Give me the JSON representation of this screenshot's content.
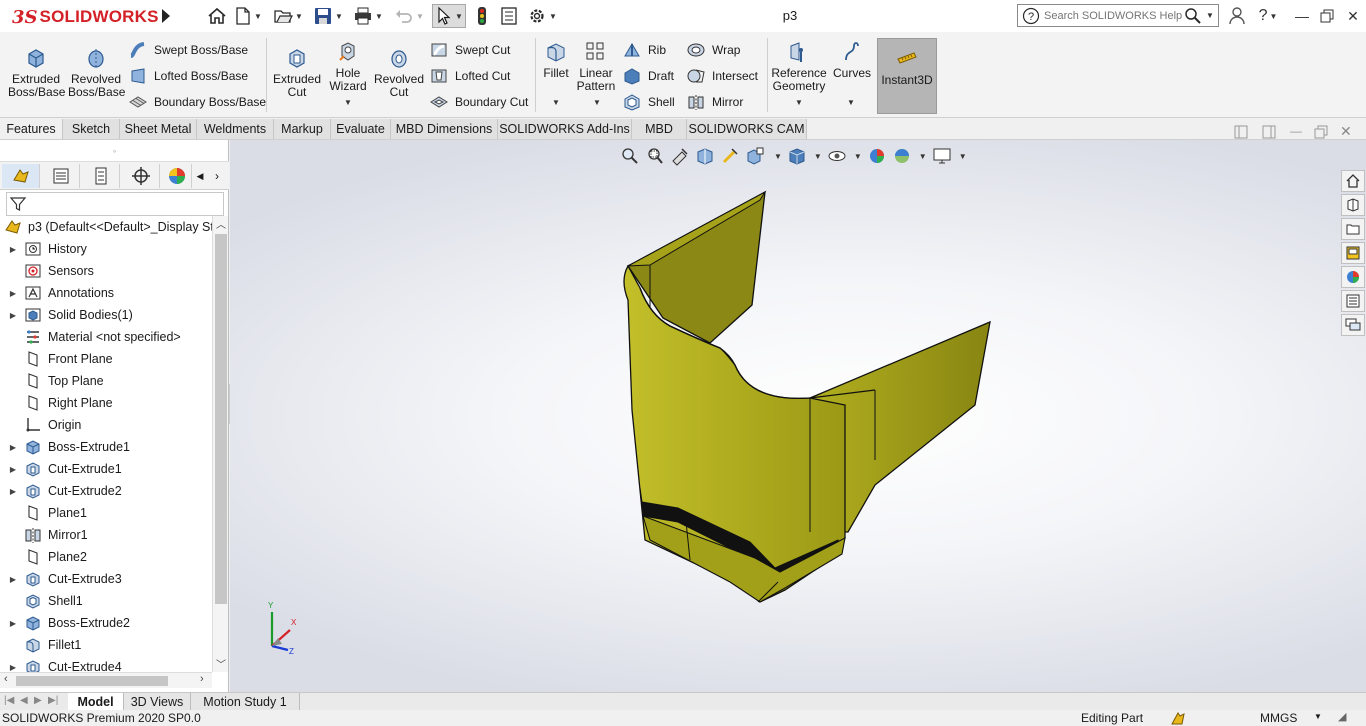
{
  "app": {
    "brand_ds": "3S",
    "brand_name": "SOLIDWORKS",
    "document_title": "p3"
  },
  "search": {
    "placeholder": "Search SOLIDWORKS Help"
  },
  "ribbon": {
    "extruded_boss": "Extruded\nBoss/Base",
    "revolved_boss": "Revolved\nBoss/Base",
    "swept_boss": "Swept Boss/Base",
    "lofted_boss": "Lofted Boss/Base",
    "boundary_boss": "Boundary Boss/Base",
    "extruded_cut": "Extruded\nCut",
    "hole_wizard": "Hole\nWizard",
    "revolved_cut": "Revolved\nCut",
    "swept_cut": "Swept Cut",
    "lofted_cut": "Lofted Cut",
    "boundary_cut": "Boundary Cut",
    "fillet": "Fillet",
    "linear_pattern": "Linear\nPattern",
    "rib": "Rib",
    "draft": "Draft",
    "shell": "Shell",
    "wrap": "Wrap",
    "intersect": "Intersect",
    "mirror": "Mirror",
    "reference_geometry": "Reference\nGeometry",
    "curves": "Curves",
    "instant3d": "Instant3D"
  },
  "tabs": [
    "Features",
    "Sketch",
    "Sheet Metal",
    "Weldments",
    "Markup",
    "Evaluate",
    "MBD Dimensions",
    "SOLIDWORKS Add-Ins",
    "MBD",
    "SOLIDWORKS CAM"
  ],
  "tree": {
    "root": "p3  (Default<<Default>_Display Sta",
    "nodes": [
      {
        "label": "History",
        "expand": true,
        "icon": "history-icon"
      },
      {
        "label": "Sensors",
        "expand": false,
        "icon": "sensors-icon"
      },
      {
        "label": "Annotations",
        "expand": true,
        "icon": "annotations-icon"
      },
      {
        "label": "Solid Bodies(1)",
        "expand": true,
        "icon": "solid-bodies-icon"
      },
      {
        "label": "Material <not specified>",
        "expand": false,
        "icon": "material-icon"
      },
      {
        "label": "Front Plane",
        "expand": false,
        "icon": "plane-icon"
      },
      {
        "label": "Top Plane",
        "expand": false,
        "icon": "plane-icon"
      },
      {
        "label": "Right Plane",
        "expand": false,
        "icon": "plane-icon"
      },
      {
        "label": "Origin",
        "expand": false,
        "icon": "origin-icon"
      },
      {
        "label": "Boss-Extrude1",
        "expand": true,
        "icon": "boss-extrude-icon"
      },
      {
        "label": "Cut-Extrude1",
        "expand": true,
        "icon": "cut-extrude-icon"
      },
      {
        "label": "Cut-Extrude2",
        "expand": true,
        "icon": "cut-extrude-icon"
      },
      {
        "label": "Plane1",
        "expand": false,
        "icon": "plane-icon"
      },
      {
        "label": "Mirror1",
        "expand": false,
        "icon": "mirror-icon"
      },
      {
        "label": "Plane2",
        "expand": false,
        "icon": "plane-icon"
      },
      {
        "label": "Cut-Extrude3",
        "expand": true,
        "icon": "cut-extrude-icon"
      },
      {
        "label": "Shell1",
        "expand": false,
        "icon": "shell-icon"
      },
      {
        "label": "Boss-Extrude2",
        "expand": true,
        "icon": "boss-extrude-icon"
      },
      {
        "label": "Fillet1",
        "expand": false,
        "icon": "fillet-icon"
      },
      {
        "label": "Cut-Extrude4",
        "expand": true,
        "icon": "cut-extrude-icon"
      }
    ]
  },
  "bottom_tabs": [
    "Model",
    "3D Views",
    "Motion Study 1"
  ],
  "status": {
    "product": "SOLIDWORKS Premium 2020 SP0.0",
    "mode": "Editing Part",
    "units": "MMGS"
  },
  "triad": {
    "x": "X",
    "y": "Y",
    "z": "Z"
  },
  "colors": {
    "brand_red": "#d42027",
    "model_yellow": "#a9a61a",
    "model_dark": "#1a1a1a"
  }
}
